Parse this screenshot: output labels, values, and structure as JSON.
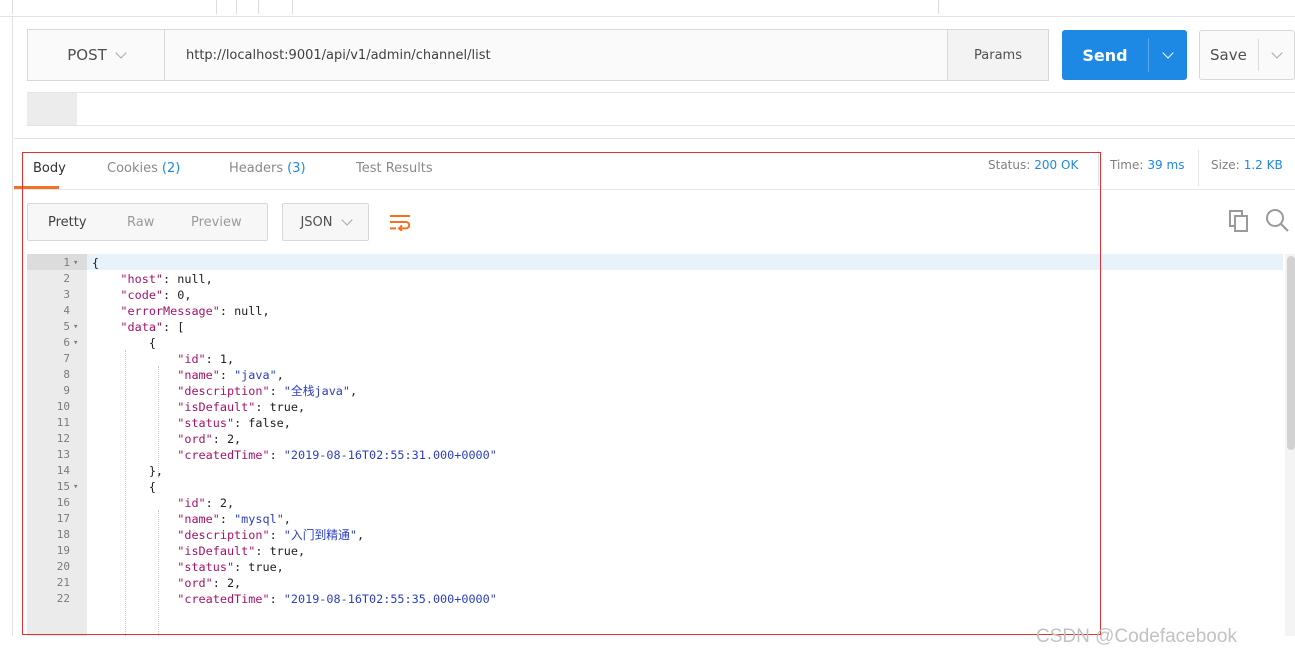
{
  "request": {
    "method": "POST",
    "url": "http://localhost:9001/api/v1/admin/channel/list",
    "params_label": "Params",
    "send_label": "Send",
    "save_label": "Save"
  },
  "response_tabs": {
    "body": "Body",
    "cookies": "Cookies",
    "cookies_count": "(2)",
    "headers": "Headers",
    "headers_count": "(3)",
    "test_results": "Test Results"
  },
  "status": {
    "status_label": "Status:",
    "status_value": "200 OK",
    "time_label": "Time:",
    "time_value": "39 ms",
    "size_label": "Size:",
    "size_value": "1.2 KB"
  },
  "format": {
    "pretty": "Pretty",
    "raw": "Raw",
    "preview": "Preview",
    "type": "JSON"
  },
  "icons": {
    "wrap": "wrap-lines-icon",
    "copy": "copy-icon",
    "search": "search-icon",
    "dropdown": "chevron-down-icon"
  },
  "colors": {
    "accent_blue": "#1e88e5",
    "active_tab_orange": "#f47023",
    "json_key": "#a6126b",
    "json_string": "#2a3fc4",
    "annotation_red": "#e03232"
  },
  "code_lines": [
    {
      "n": "1",
      "fold": "▾",
      "text": "{"
    },
    {
      "n": "2",
      "text": "    \"host\": null,"
    },
    {
      "n": "3",
      "text": "    \"code\": 0,"
    },
    {
      "n": "4",
      "text": "    \"errorMessage\": null,"
    },
    {
      "n": "5",
      "fold": "▾",
      "text": "    \"data\": ["
    },
    {
      "n": "6",
      "fold": "▾",
      "text": "        {"
    },
    {
      "n": "7",
      "text": "            \"id\": 1,"
    },
    {
      "n": "8",
      "text": "            \"name\": \"java\","
    },
    {
      "n": "9",
      "text": "            \"description\": \"全栈java\","
    },
    {
      "n": "10",
      "text": "            \"isDefault\": true,"
    },
    {
      "n": "11",
      "text": "            \"status\": false,"
    },
    {
      "n": "12",
      "text": "            \"ord\": 2,"
    },
    {
      "n": "13",
      "text": "            \"createdTime\": \"2019-08-16T02:55:31.000+0000\""
    },
    {
      "n": "14",
      "text": "        },"
    },
    {
      "n": "15",
      "fold": "▾",
      "text": "        {"
    },
    {
      "n": "16",
      "text": "            \"id\": 2,"
    },
    {
      "n": "17",
      "text": "            \"name\": \"mysql\","
    },
    {
      "n": "18",
      "text": "            \"description\": \"入门到精通\","
    },
    {
      "n": "19",
      "text": "            \"isDefault\": true,"
    },
    {
      "n": "20",
      "text": "            \"status\": true,"
    },
    {
      "n": "21",
      "text": "            \"ord\": 2,"
    },
    {
      "n": "22",
      "text": "            \"createdTime\": \"2019-08-16T02:55:35.000+0000\""
    }
  ],
  "watermark": "CSDN @Codefacebook"
}
